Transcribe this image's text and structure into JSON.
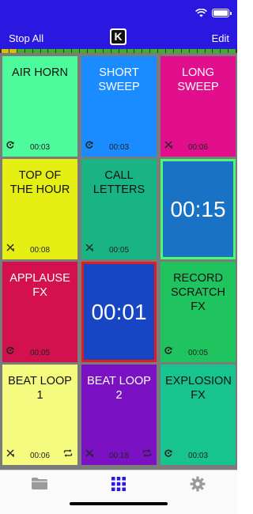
{
  "nav": {
    "left_label": "Stop All",
    "right_label": "Edit",
    "logo_letter": "K"
  },
  "meter_colors": [
    "#d6c200",
    "#d6c200",
    "#3fae2b",
    "#3fae2b",
    "#3fae2b",
    "#3fae2b",
    "#3fae2b",
    "#3fae2b",
    "#3fae2b",
    "#3fae2b",
    "#3fae2b",
    "#3fae2b",
    "#3fae2b",
    "#3fae2b",
    "#3fae2b",
    "#3fae2b",
    "#3fae2b",
    "#3fae2b",
    "#3fae2b",
    "#3fae2b",
    "#3fae2b",
    "#3fae2b",
    "#3fae2b",
    "#3fae2b",
    "#3fae2b",
    "#3fae2b",
    "#3fae2b",
    "#3fae2b",
    "#3fae2b",
    "#3fae2b"
  ],
  "pads": [
    {
      "title": "AIR HORN",
      "time": "00:03",
      "color": "#4dfb9c",
      "text_color": "#111111",
      "icon": "replay-icon"
    },
    {
      "title": "SHORT SWEEP",
      "time": "00:03",
      "color": "#1a8cff",
      "text_color": "#ffffff",
      "icon": "replay-icon"
    },
    {
      "title": "LONG SWEEP",
      "time": "00:06",
      "color": "#e20f8c",
      "text_color": "#ffffff",
      "icon": "fade-icon"
    },
    {
      "title": "TOP OF THE HOUR",
      "time": "00:08",
      "color": "#e6ef14",
      "text_color": "#111111",
      "icon": "fade-icon"
    },
    {
      "title": "CALL LETTERS",
      "time": "00:05",
      "color": "#18b483",
      "text_color": "#111111",
      "icon": "fade-icon"
    },
    {
      "big": "00:15",
      "color": "#1a72c4",
      "border": "#4dfb6e",
      "text_color": "#ffffff"
    },
    {
      "title": "APPLAUSE FX",
      "time": "00:05",
      "color": "#d4114f",
      "text_color": "#ffffff",
      "icon": "replay-icon"
    },
    {
      "big": "00:01",
      "color": "#1745c4",
      "border": "#e11c1c",
      "text_color": "#ffffff"
    },
    {
      "title": "RECORD SCRATCH FX",
      "time": "00:05",
      "color": "#1fc45e",
      "text_color": "#111111",
      "icon": "replay-icon"
    },
    {
      "title": "BEAT LOOP 1",
      "time": "00:06",
      "color": "#f4fb7e",
      "text_color": "#111111",
      "icon": "fade-icon",
      "loop": true
    },
    {
      "title": "BEAT LOOP 2",
      "time": "00:18",
      "color": "#7a12c4",
      "text_color": "#ffffff",
      "icon": "fade-icon",
      "loop": true
    },
    {
      "title": "EXPLOSION FX",
      "time": "00:03",
      "color": "#18c48d",
      "text_color": "#111111",
      "icon": "replay-icon"
    }
  ],
  "tabs": [
    {
      "name": "folder-icon",
      "active": false
    },
    {
      "name": "grid-icon",
      "active": true
    },
    {
      "name": "gear-icon",
      "active": false
    }
  ]
}
